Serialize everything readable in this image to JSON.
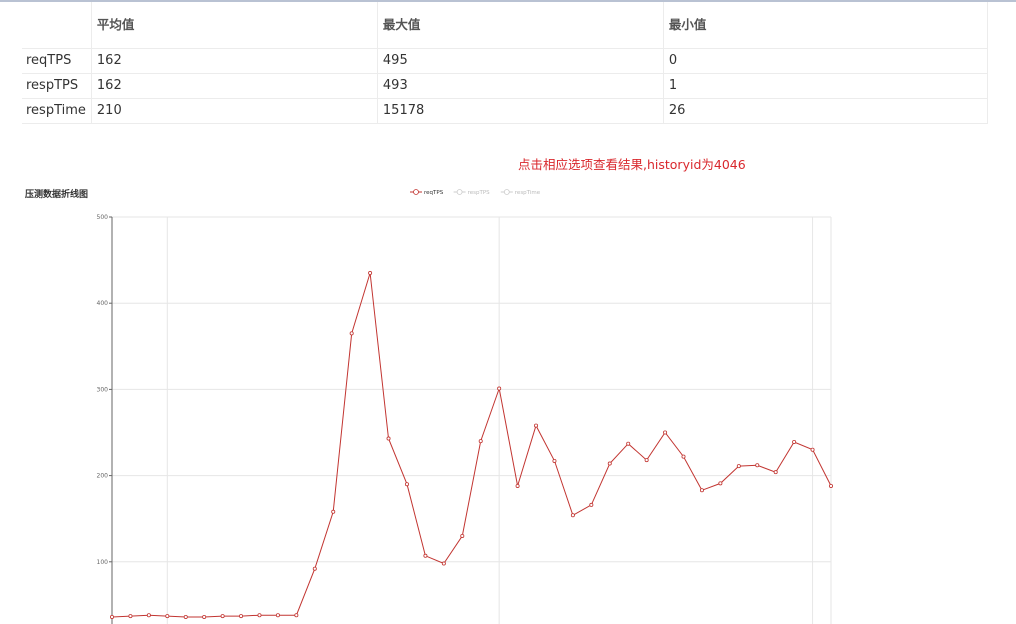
{
  "stats_table": {
    "headers": [
      "",
      "平均值",
      "最大值",
      "最小值"
    ],
    "rows": [
      {
        "name": "reqTPS",
        "avg": "162",
        "max": "495",
        "min": "0"
      },
      {
        "name": "respTPS",
        "avg": "162",
        "max": "493",
        "min": "1"
      },
      {
        "name": "respTime",
        "avg": "210",
        "max": "15178",
        "min": "26"
      }
    ]
  },
  "notice": "点击相应选项查看结果,historyid为4046",
  "chart_data": {
    "type": "line",
    "title": "压测数据折线图",
    "legend": [
      "reqTPS",
      "respTPS",
      "respTime"
    ],
    "active_series": "reqTPS",
    "ylim": [
      0,
      500
    ],
    "yticks": [
      "100",
      "200",
      "300",
      "400",
      "500"
    ],
    "grid": true,
    "legend_placement": "top-center",
    "colors": {
      "reqTPS": "#c23531",
      "inactive": "#cccccc"
    },
    "series": [
      {
        "name": "reqTPS",
        "values": [
          36,
          37,
          38,
          37,
          36,
          36,
          37,
          37,
          38,
          38,
          38,
          92,
          158,
          365,
          435,
          243,
          190,
          107,
          98,
          130,
          240,
          301,
          188,
          258,
          217,
          154,
          166,
          214,
          237,
          218,
          250,
          222,
          183,
          191,
          211,
          212,
          204,
          239,
          230,
          188
        ]
      }
    ]
  }
}
